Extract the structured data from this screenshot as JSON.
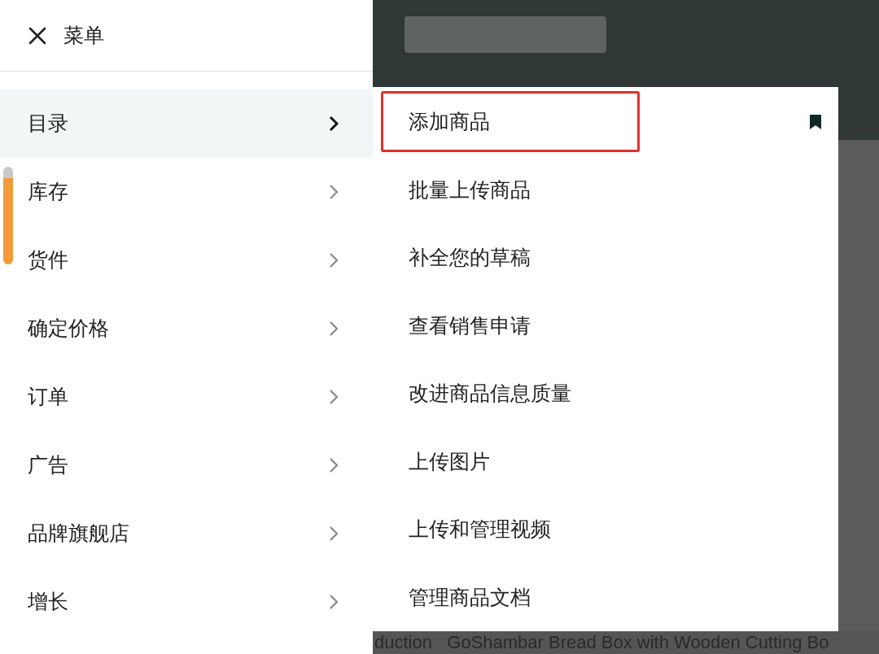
{
  "menu_header": {
    "title": "菜单"
  },
  "menu_items": [
    {
      "label": "目录",
      "selected": true
    },
    {
      "label": "库存",
      "selected": false
    },
    {
      "label": "货件",
      "selected": false
    },
    {
      "label": "确定价格",
      "selected": false
    },
    {
      "label": "订单",
      "selected": false
    },
    {
      "label": "广告",
      "selected": false
    },
    {
      "label": "品牌旗舰店",
      "selected": false
    },
    {
      "label": "增长",
      "selected": false
    }
  ],
  "submenu_items": [
    {
      "label": "添加商品",
      "highlighted": true,
      "bookmarked": true
    },
    {
      "label": "批量上传商品",
      "highlighted": false,
      "bookmarked": false
    },
    {
      "label": "补全您的草稿",
      "highlighted": false,
      "bookmarked": false
    },
    {
      "label": "查看销售申请",
      "highlighted": false,
      "bookmarked": false
    },
    {
      "label": "改进商品信息质量",
      "highlighted": false,
      "bookmarked": false
    },
    {
      "label": "上传图片",
      "highlighted": false,
      "bookmarked": false
    },
    {
      "label": "上传和管理视频",
      "highlighted": false,
      "bookmarked": false
    },
    {
      "label": "管理商品文档",
      "highlighted": false,
      "bookmarked": false
    }
  ],
  "background": {
    "product_line": "duction   GoShambar Bread Box with Wooden Cutting Bo"
  }
}
